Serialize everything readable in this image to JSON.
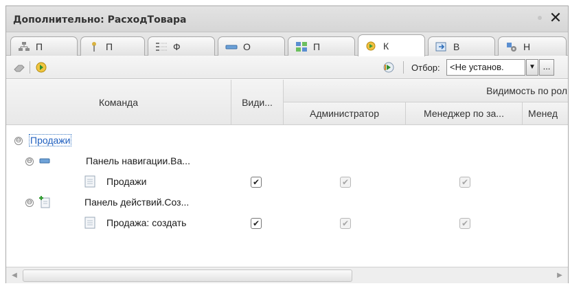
{
  "window": {
    "title": "Дополнительно: РасходТовара"
  },
  "tabs": [
    {
      "label": "П",
      "icon": "hierarchy-icon"
    },
    {
      "label": "П",
      "icon": "key-icon"
    },
    {
      "label": "Ф",
      "icon": "form-icon"
    },
    {
      "label": "О",
      "icon": "bar-icon"
    },
    {
      "label": "П",
      "icon": "subsystem-icon"
    },
    {
      "label": "К",
      "icon": "command-icon",
      "active": true
    },
    {
      "label": "В",
      "icon": "input-icon"
    },
    {
      "label": "Н",
      "icon": "settings-icon"
    }
  ],
  "toolbar": {
    "filter_label": "Отбор:",
    "filter_value": "<Не установ.",
    "filter_drop": "▼",
    "filter_more": "..."
  },
  "columns": {
    "command": "Команда",
    "visible": "Види...",
    "visibility_by_roles": "Видимость по рол",
    "roles": [
      "Администратор",
      "Менеджер по за...",
      "Менед"
    ]
  },
  "rows": [
    {
      "label": "Продажи",
      "level": 0,
      "expanded": true,
      "selected": true
    },
    {
      "label": "Панель навигации.Ва...",
      "level": 1,
      "expanded": true,
      "icon": "navigation-panel-icon"
    },
    {
      "label": "Продажи",
      "level": 2,
      "icon": "document-icon",
      "visible": true,
      "roles": [
        true,
        true
      ]
    },
    {
      "label": "Панель действий.Соз...",
      "level": 1,
      "expanded": true,
      "icon": "action-panel-icon"
    },
    {
      "label": "Продажа: создать",
      "level": 2,
      "icon": "document-icon",
      "visible": true,
      "roles": [
        true,
        true
      ]
    }
  ],
  "glyphs": {
    "collapse": "⊖",
    "check": "✔",
    "close": "✕",
    "left": "◀",
    "right": "▶"
  }
}
